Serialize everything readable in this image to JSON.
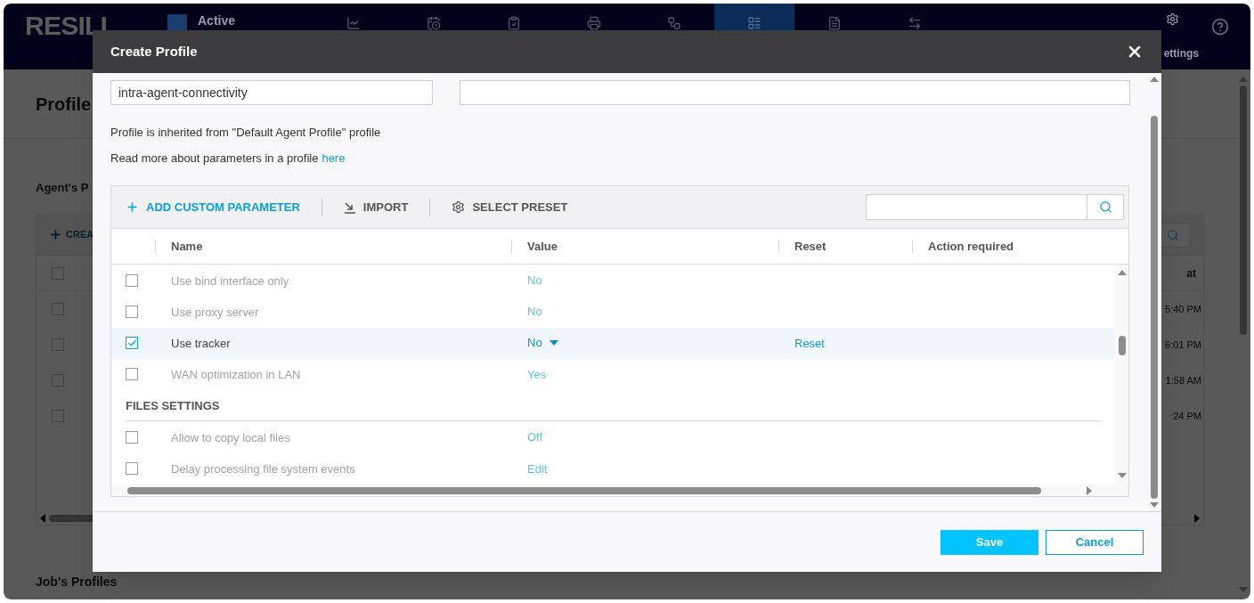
{
  "app": {
    "logo": "RESILI",
    "product": "Active",
    "nav": [
      {
        "selected": false
      },
      {
        "selected": false
      },
      {
        "selected": false
      },
      {
        "selected": false
      },
      {
        "selected": false
      },
      {
        "selected": true
      },
      {
        "selected": false
      },
      {
        "selected": false
      }
    ],
    "settings": "ettings"
  },
  "page": {
    "title": "Profile",
    "agent_section": "Agent's P",
    "create": "CREA",
    "column_heading": "at",
    "select_all": {
      "checked": false
    },
    "rows": [
      {
        "time": "5:40 PM",
        "checked": false
      },
      {
        "time": "6:01 PM",
        "checked": false
      },
      {
        "time": "1:58 AM",
        "checked": false
      },
      {
        "time": ":24 PM",
        "checked": false
      }
    ],
    "jobs_section": "Job's Profiles"
  },
  "dialog": {
    "title": "Create Profile",
    "name_field": {
      "value": "intra-agent-connectivity"
    },
    "inherited_note": "Profile is inherited from \"Default Agent Profile\" profile",
    "read_more": "Read more about parameters in a profile",
    "read_more_link": "here",
    "toolbar": {
      "add": "ADD CUSTOM PARAMETER",
      "import": "IMPORT",
      "preset": "SELECT PRESET"
    },
    "columns": [
      "Name",
      "Value",
      "Reset",
      "Action required"
    ],
    "rows": [
      {
        "kind": "param",
        "name": "Use bind interface only",
        "value": "No",
        "checked": false
      },
      {
        "kind": "param",
        "name": "Use proxy server",
        "value": "No",
        "checked": false
      },
      {
        "kind": "param",
        "name": "Use tracker",
        "value": "No",
        "checked": true,
        "reset": "Reset"
      },
      {
        "kind": "param",
        "name": "WAN optimization in LAN",
        "value": "Yes",
        "checked": false
      },
      {
        "kind": "section",
        "name": "FILES SETTINGS"
      },
      {
        "kind": "param",
        "name": "Allow to copy local files",
        "value": "Off",
        "checked": false
      },
      {
        "kind": "param",
        "name": "Delay processing file system events",
        "value": "Edit",
        "checked": false
      }
    ],
    "buttons": {
      "save": "Save",
      "cancel": "Cancel"
    }
  }
}
